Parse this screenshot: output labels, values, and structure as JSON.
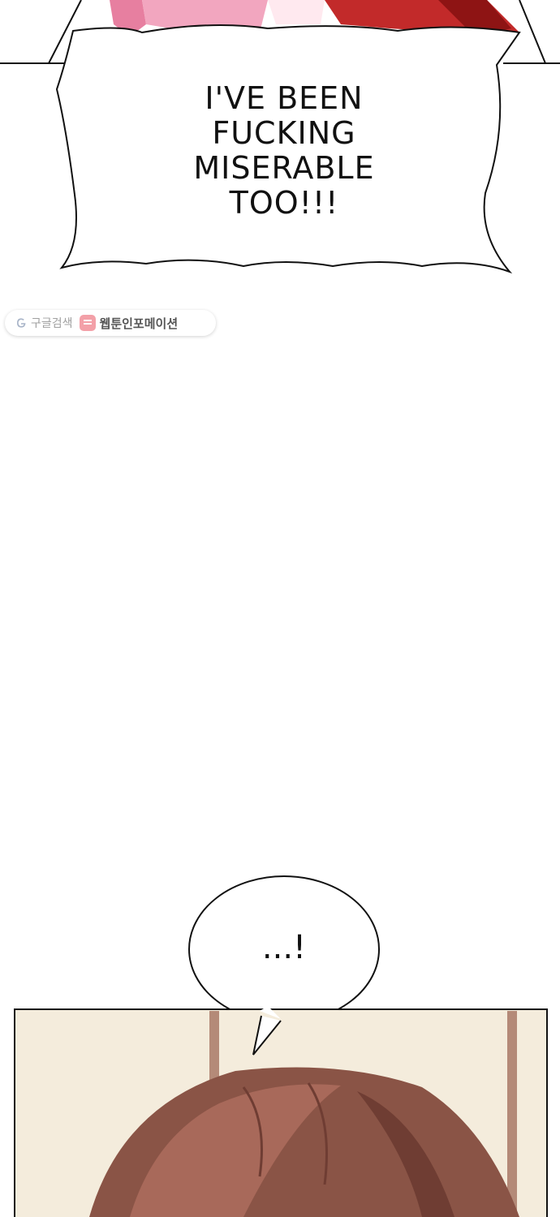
{
  "top_bubble": {
    "lines": [
      "I'VE BEEN",
      "FUCKING",
      "MISERABLE",
      "TOO!!!"
    ]
  },
  "watermark": {
    "search_label": "구글검색",
    "brand_label": "웹툰인포메이션"
  },
  "bottom_bubble": {
    "text": "...!"
  },
  "colors": {
    "hair_brown": "#8a5446",
    "panel_bg": "#f4ecdc",
    "pink_hair": "#f0a0b8",
    "red_hair": "#c0282a"
  }
}
